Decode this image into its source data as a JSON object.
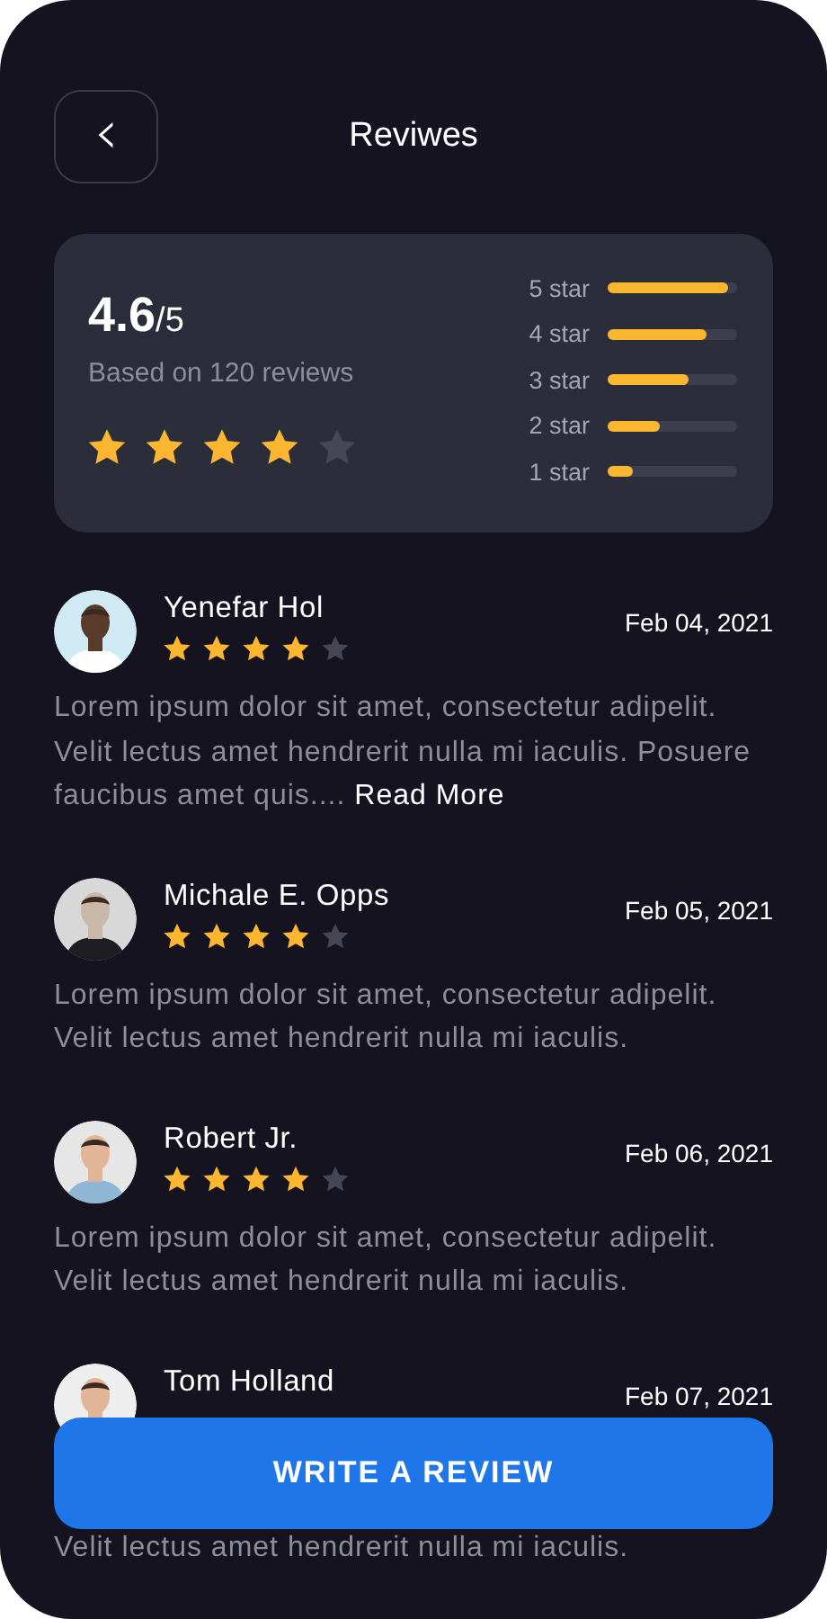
{
  "header": {
    "back_icon": "‹",
    "title": "Reviwes"
  },
  "summary": {
    "rating": "4.6",
    "out_of": "/5",
    "based_on": "Based on 120 reviews",
    "stars": 4,
    "bars": [
      {
        "label": "5 star",
        "level": 0.93
      },
      {
        "label": "4 star",
        "level": 0.77
      },
      {
        "label": "3 star",
        "level": 0.63
      },
      {
        "label": "2 star",
        "level": 0.4
      },
      {
        "label": "1 star",
        "level": 0.19
      }
    ]
  },
  "reviews": [
    {
      "name": "Yenefar Hol",
      "date": "Feb 04, 2021",
      "stars": 4,
      "text": "Lorem ipsum dolor sit amet, consectetur adipelit. Velit lectus amet hendrerit nulla mi iaculis. Posuere faucibus amet quis....",
      "read_more": "Read More"
    },
    {
      "name": "Michale E. Opps",
      "date": "Feb 05, 2021",
      "stars": 4,
      "text": "Lorem ipsum dolor sit amet, consectetur adipelit. Velit lectus amet hendrerit nulla mi iaculis."
    },
    {
      "name": "Robert Jr.",
      "date": "Feb 06, 2021",
      "stars": 4,
      "text": "Lorem ipsum dolor sit amet, consectetur adipelit. Velit lectus amet hendrerit nulla mi iaculis."
    },
    {
      "name": "Tom Holland",
      "date": "Feb 07, 2021",
      "text": "Velit lectus amet hendrerit nulla mi iaculis."
    }
  ],
  "write_button": "WRITE A REVIEW"
}
